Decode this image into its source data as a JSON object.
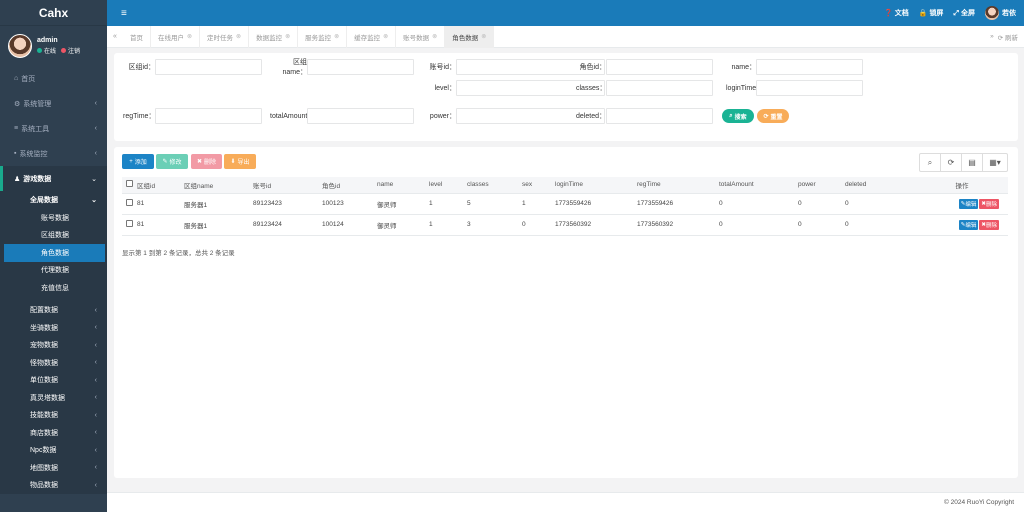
{
  "brand": "Cahx",
  "user": {
    "name": "admin",
    "status": "在线",
    "logout": "注销"
  },
  "colors": {
    "sidebar": "#2f4050",
    "topbar": "#1a7bb9",
    "online": "#1ab394",
    "logout": "#ed5565"
  },
  "sidebar": {
    "home": "首页",
    "groups": [
      {
        "label": "系统管理",
        "icon": "gear-icon"
      },
      {
        "label": "系统工具",
        "icon": "bars-icon"
      },
      {
        "label": "系统监控",
        "icon": "video-icon"
      }
    ],
    "game": {
      "label": "游戏数据",
      "all_label": "全局数据",
      "all_items": [
        "账号数据",
        "区组数据",
        "角色数据",
        "代理数据",
        "充值信息"
      ],
      "sub_groups": [
        "配置数据",
        "坐骑数据",
        "宠物数据",
        "怪物数据",
        "单位数据",
        "真灵塔数据",
        "技能数据",
        "商店数据",
        "Npc数据",
        "地图数据",
        "物品数据"
      ]
    }
  },
  "topbar": {
    "docs": "文档",
    "lock": "锁屏",
    "fullscreen": "全屏",
    "username": "若依"
  },
  "tabs": [
    "首页",
    "在线用户",
    "定时任务",
    "数据监控",
    "服务监控",
    "缓存监控",
    "账号数据",
    "角色数据"
  ],
  "active_tab": "角色数据",
  "refresh": "刷新",
  "search": {
    "fields": [
      {
        "label": "区组id："
      },
      {
        "label": "区组name："
      },
      {
        "label": "账号id："
      },
      {
        "label": "角色id："
      },
      {
        "label": "name："
      },
      {
        "label": "level："
      },
      {
        "label": "classes："
      },
      {
        "label": "loginTime："
      },
      {
        "label": "regTime："
      },
      {
        "label": "totalAmount："
      },
      {
        "label": "power："
      },
      {
        "label": "deleted："
      }
    ],
    "search_btn": "搜索",
    "reset_btn": "重置"
  },
  "toolbar": {
    "add": "添加",
    "edit": "修改",
    "delete": "删除",
    "export": "导出"
  },
  "table": {
    "columns": [
      "区组id",
      "区组name",
      "账号id",
      "角色id",
      "name",
      "level",
      "classes",
      "sex",
      "loginTime",
      "regTime",
      "totalAmount",
      "power",
      "deleted",
      "操作"
    ],
    "rows": [
      [
        "81",
        "服务器1",
        "89123423",
        "100123",
        "御灵师",
        "1",
        "5",
        "1",
        "1773559426",
        "1773559426",
        "0",
        "0",
        "0"
      ],
      [
        "81",
        "服务器1",
        "89123424",
        "100124",
        "御灵师",
        "1",
        "3",
        "0",
        "1773560392",
        "1773560392",
        "0",
        "0",
        "0"
      ]
    ],
    "row_edit": "编辑",
    "row_delete": "删除"
  },
  "pager": "显示第 1 到第 2 条记录，总共 2 条记录",
  "footer": "© 2024 RuoYi Copyright"
}
